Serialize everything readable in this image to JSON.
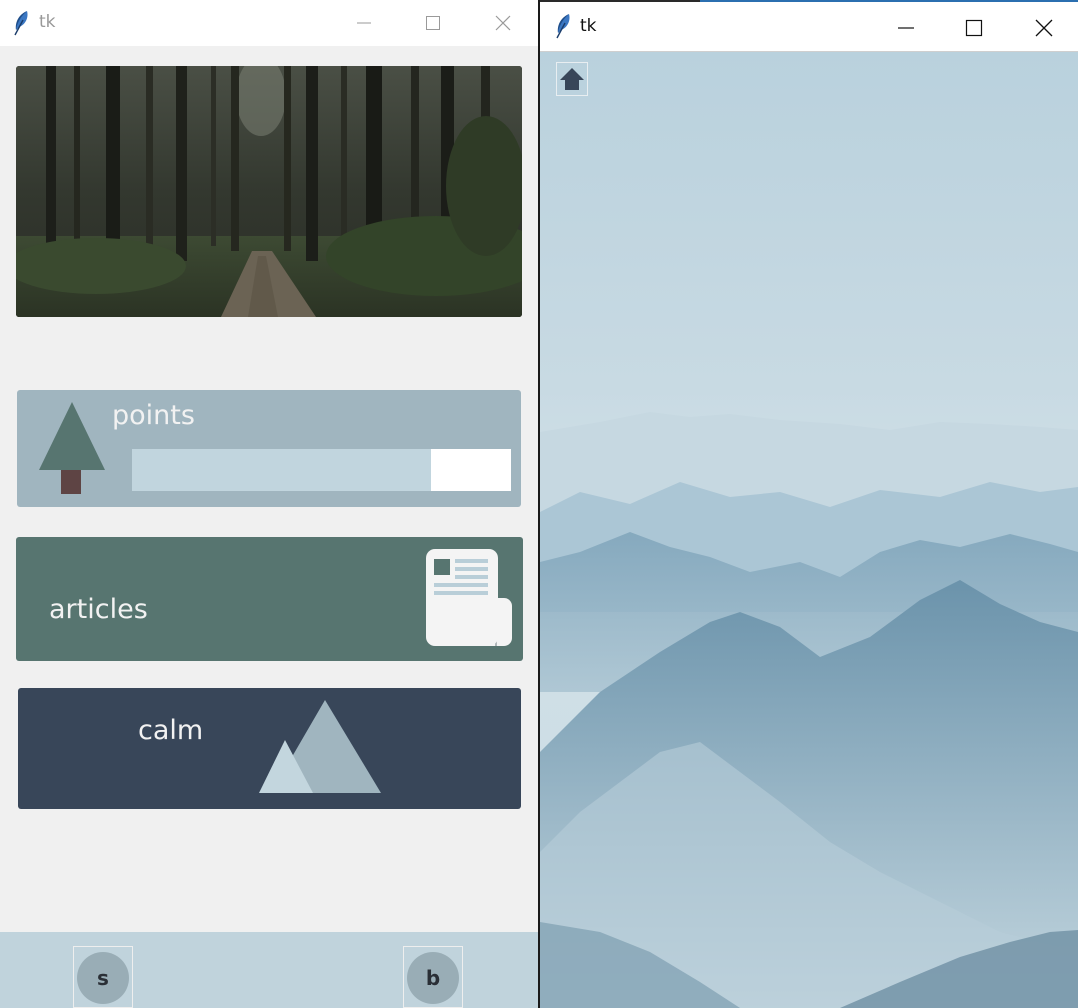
{
  "left_window": {
    "title": "tk",
    "icons": {
      "app": "feather-icon",
      "minimize": "minimize-icon",
      "maximize": "maximize-icon",
      "close": "close-icon"
    },
    "banner_image": "forest-path-photo",
    "points": {
      "label": "points",
      "icon": "tree-icon",
      "progress_fraction": 0.79
    },
    "articles": {
      "label": "articles",
      "icon": "newspaper-icon"
    },
    "calm": {
      "label": "calm",
      "icon": "mountain-icon"
    },
    "bottom_nav": {
      "s_label": "s",
      "b_label": "b"
    }
  },
  "right_window": {
    "title": "tk",
    "icons": {
      "app": "feather-icon",
      "minimize": "minimize-icon",
      "maximize": "maximize-icon",
      "close": "close-icon",
      "home": "home-icon"
    },
    "background_image": "misty-mountains-photo"
  },
  "colors": {
    "window_bg": "#f0f0f0",
    "points_card": "#a0b5bf",
    "articles_card": "#577570",
    "calm_card": "#384659",
    "bottom_bar": "#c0d3dc",
    "progress_fill": "#c1d5de",
    "sky": "#bfd4de"
  }
}
